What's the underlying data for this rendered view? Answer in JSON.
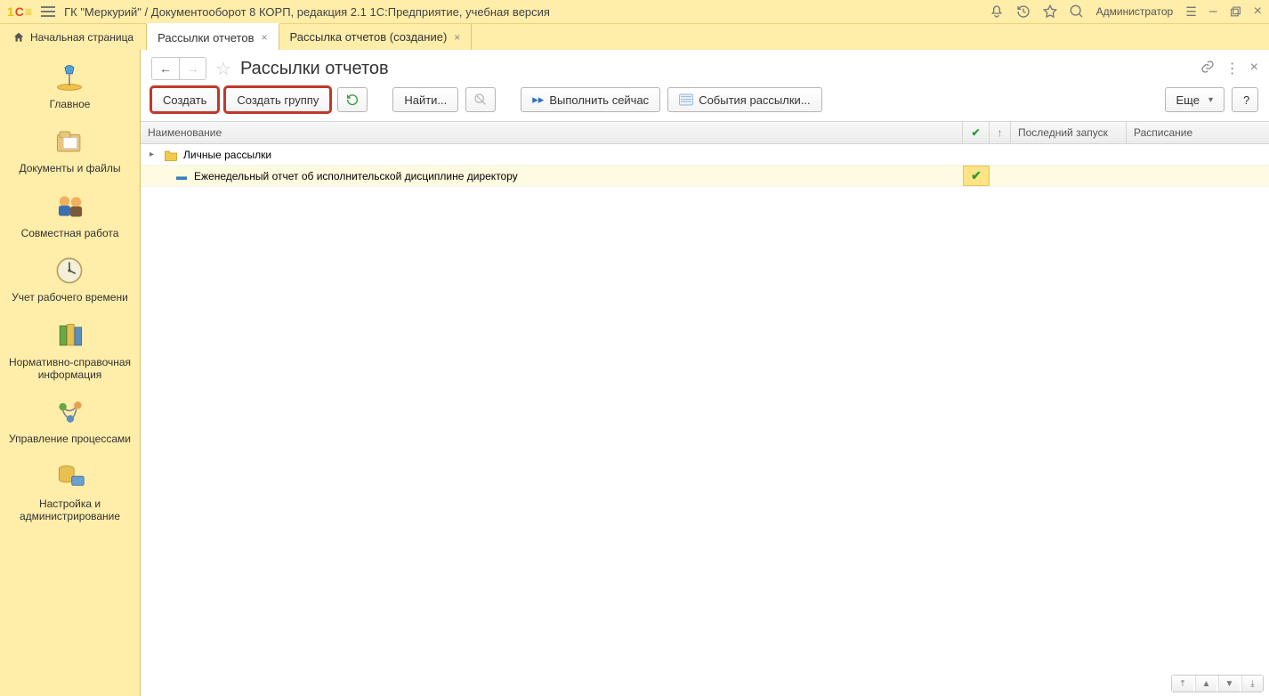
{
  "titlebar": {
    "title": "ГК \"Меркурий\" / Документооборот 8 КОРП, редакция 2.1 1С:Предприятие, учебная версия",
    "user": "Администратор"
  },
  "tabs": {
    "home": "Начальная страница",
    "items": [
      {
        "label": "Рассылки отчетов",
        "active": true
      },
      {
        "label": "Рассылка отчетов (создание)",
        "active": false
      }
    ]
  },
  "sidebar": {
    "items": [
      {
        "label": "Главное"
      },
      {
        "label": "Документы и файлы"
      },
      {
        "label": "Совместная работа"
      },
      {
        "label": "Учет рабочего времени"
      },
      {
        "label": "Нормативно-справочная информация"
      },
      {
        "label": "Управление процессами"
      },
      {
        "label": "Настройка и администрирование"
      }
    ]
  },
  "page": {
    "title": "Рассылки отчетов"
  },
  "toolbar": {
    "create": "Создать",
    "create_group": "Создать группу",
    "find": "Найти...",
    "execute_now": "Выполнить сейчас",
    "events": "События рассылки...",
    "more": "Еще",
    "help": "?"
  },
  "table": {
    "headers": {
      "name": "Наименование",
      "lastrun": "Последний запуск",
      "schedule": "Расписание"
    },
    "group": {
      "label": "Личные рассылки"
    },
    "rows": [
      {
        "name": "Еженедельный отчет об исполнительской дисциплине директору",
        "flag": true
      }
    ]
  }
}
